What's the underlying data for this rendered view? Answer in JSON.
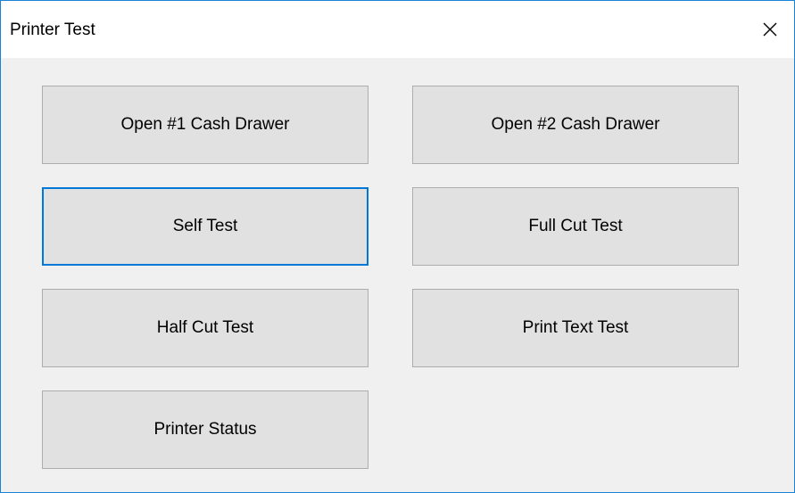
{
  "window": {
    "title": "Printer Test",
    "close_icon": "close-icon"
  },
  "buttons": {
    "open_drawer_1": "Open #1 Cash Drawer",
    "open_drawer_2": "Open #2 Cash Drawer",
    "self_test": "Self Test",
    "full_cut_test": "Full Cut Test",
    "half_cut_test": "Half Cut Test",
    "print_text_test": "Print Text Test",
    "printer_status": "Printer Status"
  },
  "focused_button": "Self Test",
  "colors": {
    "accent": "#0078d7",
    "button_face": "#e1e1e1",
    "dialog_bg": "#f0f0f0"
  }
}
